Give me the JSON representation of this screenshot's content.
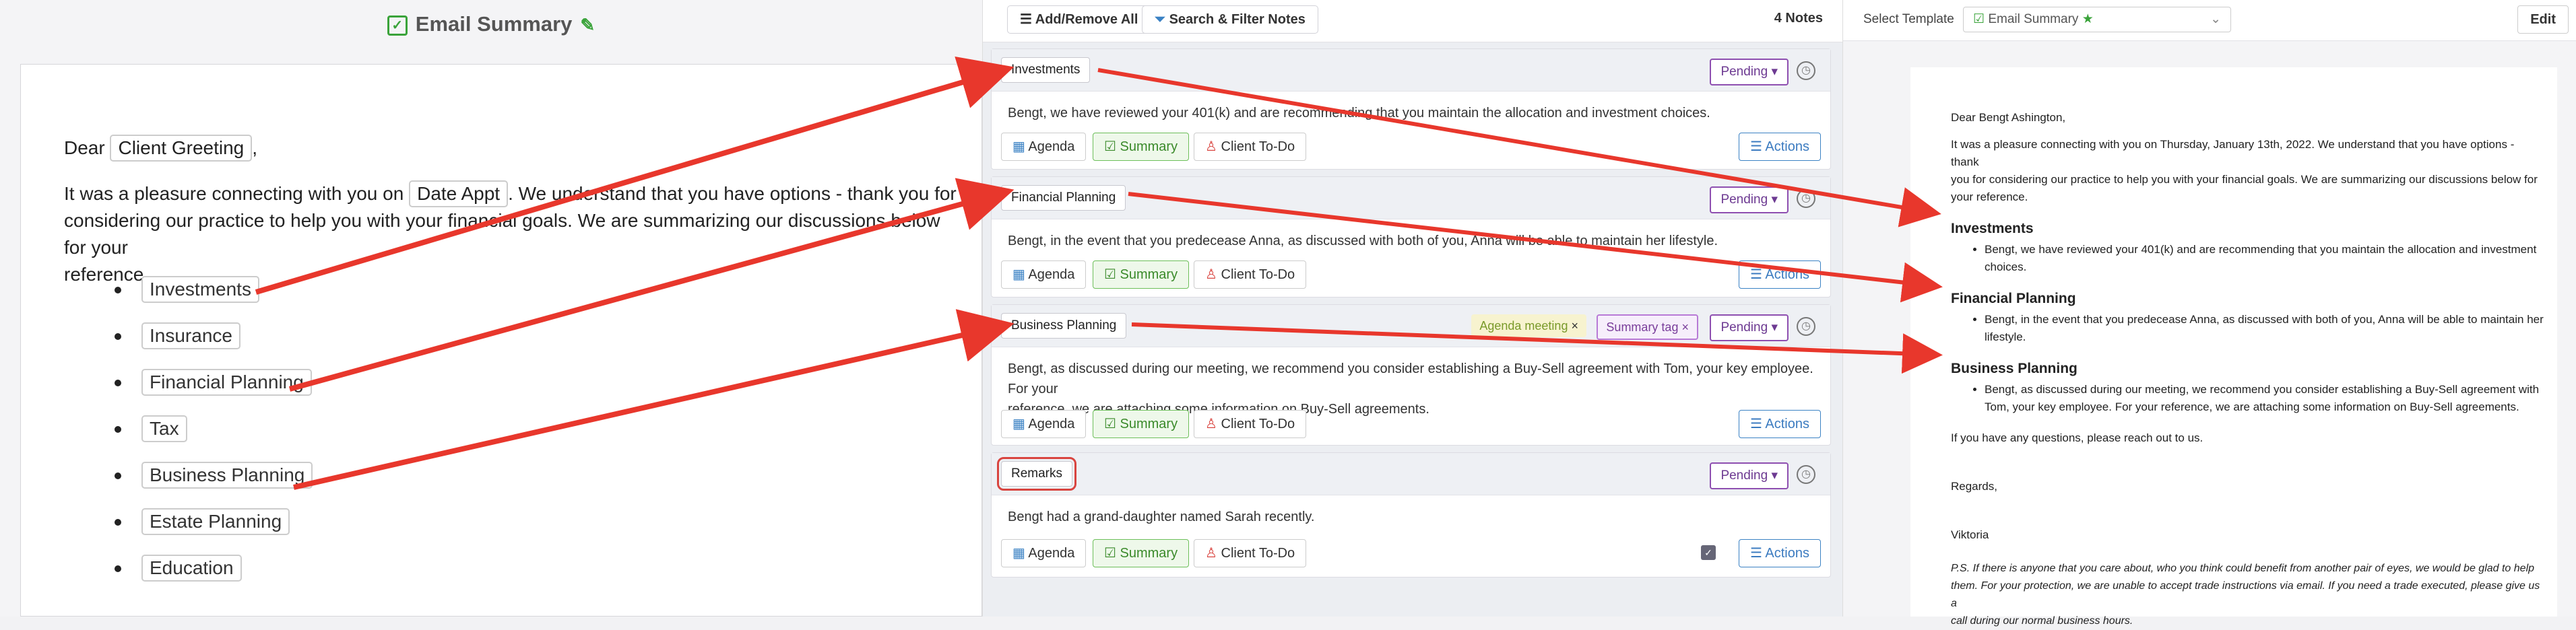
{
  "template": {
    "title": "Email Summary",
    "greeting_prefix": "Dear",
    "greeting_chip": "Client Greeting",
    "greeting_suffix": ",",
    "para_prefix": "It was a pleasure connecting with you on",
    "para_chip": "Date Appt",
    "para_rest_1": ". We understand that you have options - thank you for",
    "para_line2": "considering our practice to help you with your financial goals. We are summarizing our discussions below for your",
    "para_line3": "reference.",
    "sections": [
      "Investments",
      "Insurance",
      "Financial Planning",
      "Tax",
      "Business Planning",
      "Estate Planning",
      "Education"
    ]
  },
  "notes_panel": {
    "add_remove_label": "Add/Remove All",
    "search_filter_label": "Search & Filter Notes",
    "count_label": "4 Notes",
    "notes": [
      {
        "title": "Investments",
        "status": "Pending",
        "body": "Bengt, we have reviewed your 401(k) and are recommending that you maintain the allocation and investment choices.",
        "tags": []
      },
      {
        "title": "Financial Planning",
        "status": "Pending",
        "body": "Bengt, in the event that you predecease Anna, as discussed with both of you, Anna will be able to maintain her lifestyle.",
        "tags": []
      },
      {
        "title": "Business Planning",
        "status": "Pending",
        "body_line1": "Bengt, as discussed during our meeting, we recommend you consider establishing a Buy-Sell agreement with Tom, your key employee. For your",
        "body_line2": "reference, we are attaching some information on Buy-Sell agreements.",
        "tags": [
          "Agenda meeting",
          "Summary tag"
        ]
      },
      {
        "title": "Remarks",
        "status": "Pending",
        "body": "Bengt had a grand-daughter named Sarah recently.",
        "tags": []
      }
    ],
    "agenda_label": "Agenda",
    "summary_label": "Summary",
    "client_todo_label": "Client To-Do",
    "actions_label": "Actions"
  },
  "preview_panel": {
    "select_template_label": "Select Template",
    "template_selected": "Email Summary",
    "edit_label": "Edit",
    "greeting": "Dear Bengt Ashington,",
    "intro_1": "It was a pleasure connecting with you on Thursday, January 13th, 2022. We understand that you have options - thank",
    "intro_2": "you for considering our practice to help you with your financial goals. We are summarizing our discussions below for",
    "intro_3": "your reference.",
    "sections": [
      {
        "heading": "Investments",
        "l1": "Bengt, we have reviewed your 401(k) and are recommending that you maintain the allocation and investment",
        "l2": "choices."
      },
      {
        "heading": "Financial Planning",
        "l1": "Bengt, in the event that you predecease Anna, as discussed with both of you, Anna will be able to maintain her",
        "l2": "lifestyle."
      },
      {
        "heading": "Business Planning",
        "l1": "Bengt, as discussed during our meeting, we recommend you consider establishing a Buy-Sell agreement with",
        "l2": "Tom, your key employee. For your reference, we are attaching some information on Buy-Sell agreements."
      }
    ],
    "questions": "If you have any questions, please reach out to us.",
    "regards": "Regards,",
    "signature": "Viktoria",
    "ps_1": "P.S. If there is anyone that you care about, who you think could benefit from another pair of eyes, we would be glad to help",
    "ps_2": "them. For your protection, we are unable to accept trade instructions via email. If you need a trade executed, please give us a",
    "ps_3": "call during our normal business hours."
  },
  "colors": {
    "arrow": "#e8372c",
    "green": "#3aa33a",
    "purple": "#8e4fb0",
    "blue": "#3b82c4"
  }
}
